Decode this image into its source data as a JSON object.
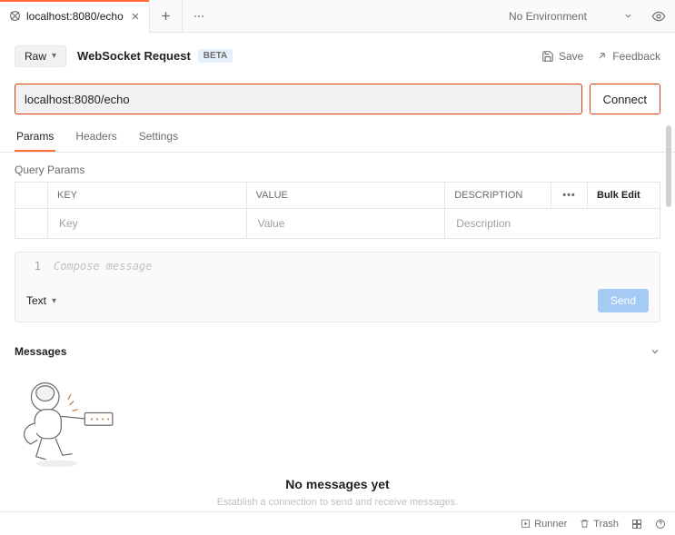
{
  "tab": {
    "title": "localhost:8080/echo"
  },
  "env": {
    "selected": "No Environment"
  },
  "request": {
    "mode_label": "Raw",
    "title": "WebSocket Request",
    "beta_label": "BETA",
    "save_label": "Save",
    "feedback_label": "Feedback",
    "url_value": "localhost:8080/echo",
    "connect_label": "Connect"
  },
  "tabs": {
    "params": "Params",
    "headers": "Headers",
    "settings": "Settings"
  },
  "params": {
    "section_label": "Query Params",
    "columns": {
      "key": "KEY",
      "value": "VALUE",
      "desc": "DESCRIPTION",
      "bulk": "Bulk Edit"
    },
    "row_placeholders": {
      "key": "Key",
      "value": "Value",
      "desc": "Description"
    }
  },
  "compose": {
    "line_number": "1",
    "placeholder": "Compose message",
    "type_label": "Text",
    "send_label": "Send"
  },
  "messages": {
    "header": "Messages",
    "empty_title": "No messages yet",
    "empty_sub": "Establish a connection to send and receive messages."
  },
  "footer": {
    "runner": "Runner",
    "trash": "Trash"
  }
}
